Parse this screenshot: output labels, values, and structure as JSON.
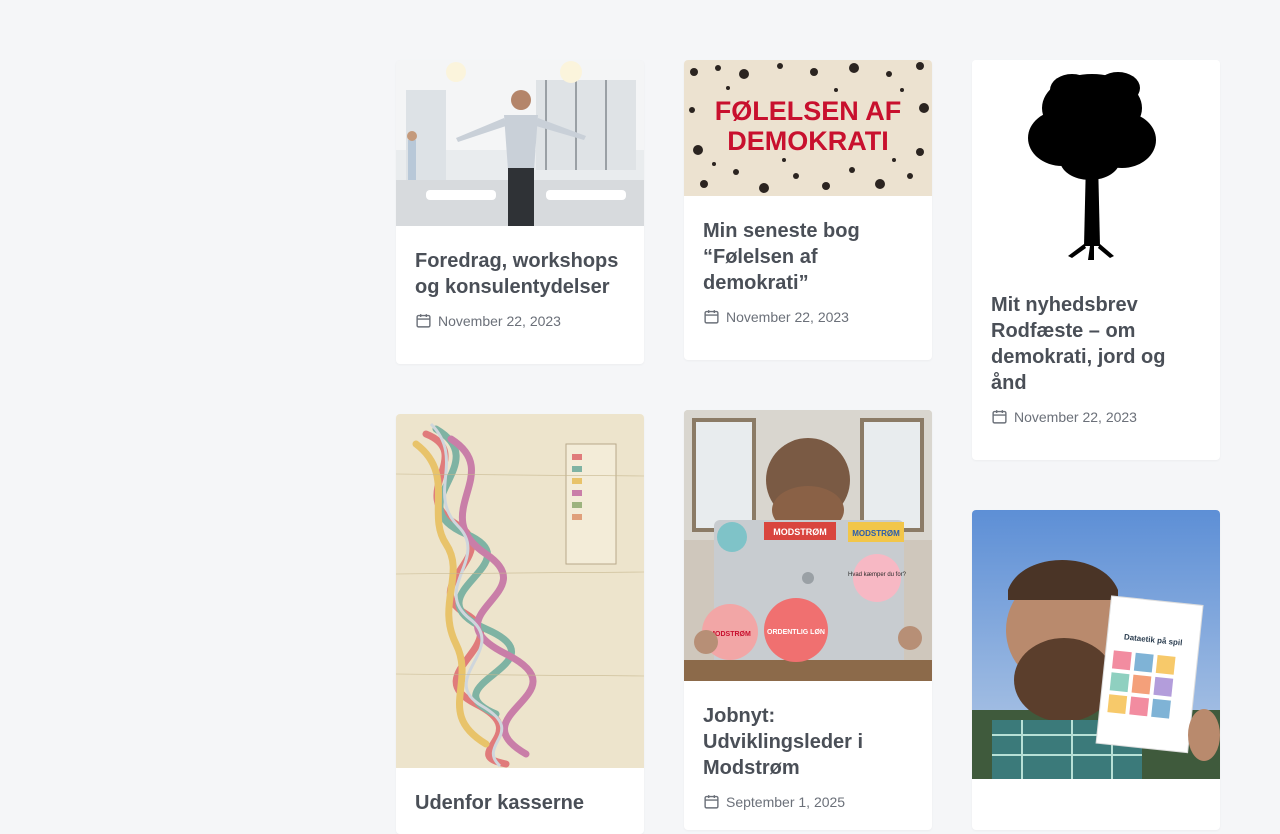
{
  "posts": [
    {
      "title": "Foredrag, workshops og konsulentydelser",
      "date": "November 22, 2023",
      "image_icon": "speaker-photo"
    },
    {
      "title": "Min seneste bog “Følelsen af demokrati”",
      "date": "November 22, 2023",
      "image_text": "FØLELSEN AF DEMOKRATI",
      "image_icon": "book-cover"
    },
    {
      "title": "Mit nyhedsbrev Rodfæste – om demokrati, jord og ånd",
      "date": "November 22, 2023",
      "image_icon": "tree-silhouette"
    },
    {
      "title": "Udenfor kasserne",
      "date": "",
      "image_icon": "river-map"
    },
    {
      "title": "Jobnyt: Udviklingsleder i Modstrøm",
      "date": "September 1, 2025",
      "image_icon": "laptop-stickers-photo",
      "image_text": [
        "MODSTRØM",
        "MODSTRØM",
        "Hvad kæmper du for?",
        "MODSTRØM",
        "ORDENTLIG LØN"
      ]
    },
    {
      "title": "",
      "date": "",
      "image_icon": "book-selfie-photo",
      "image_text": [
        "Dataetik på spil"
      ]
    }
  ],
  "colors": {
    "background": "#f5f6f8",
    "card": "#ffffff",
    "text": "#4a4f57",
    "meta": "#6b7079",
    "book_red": "#c8102e"
  }
}
